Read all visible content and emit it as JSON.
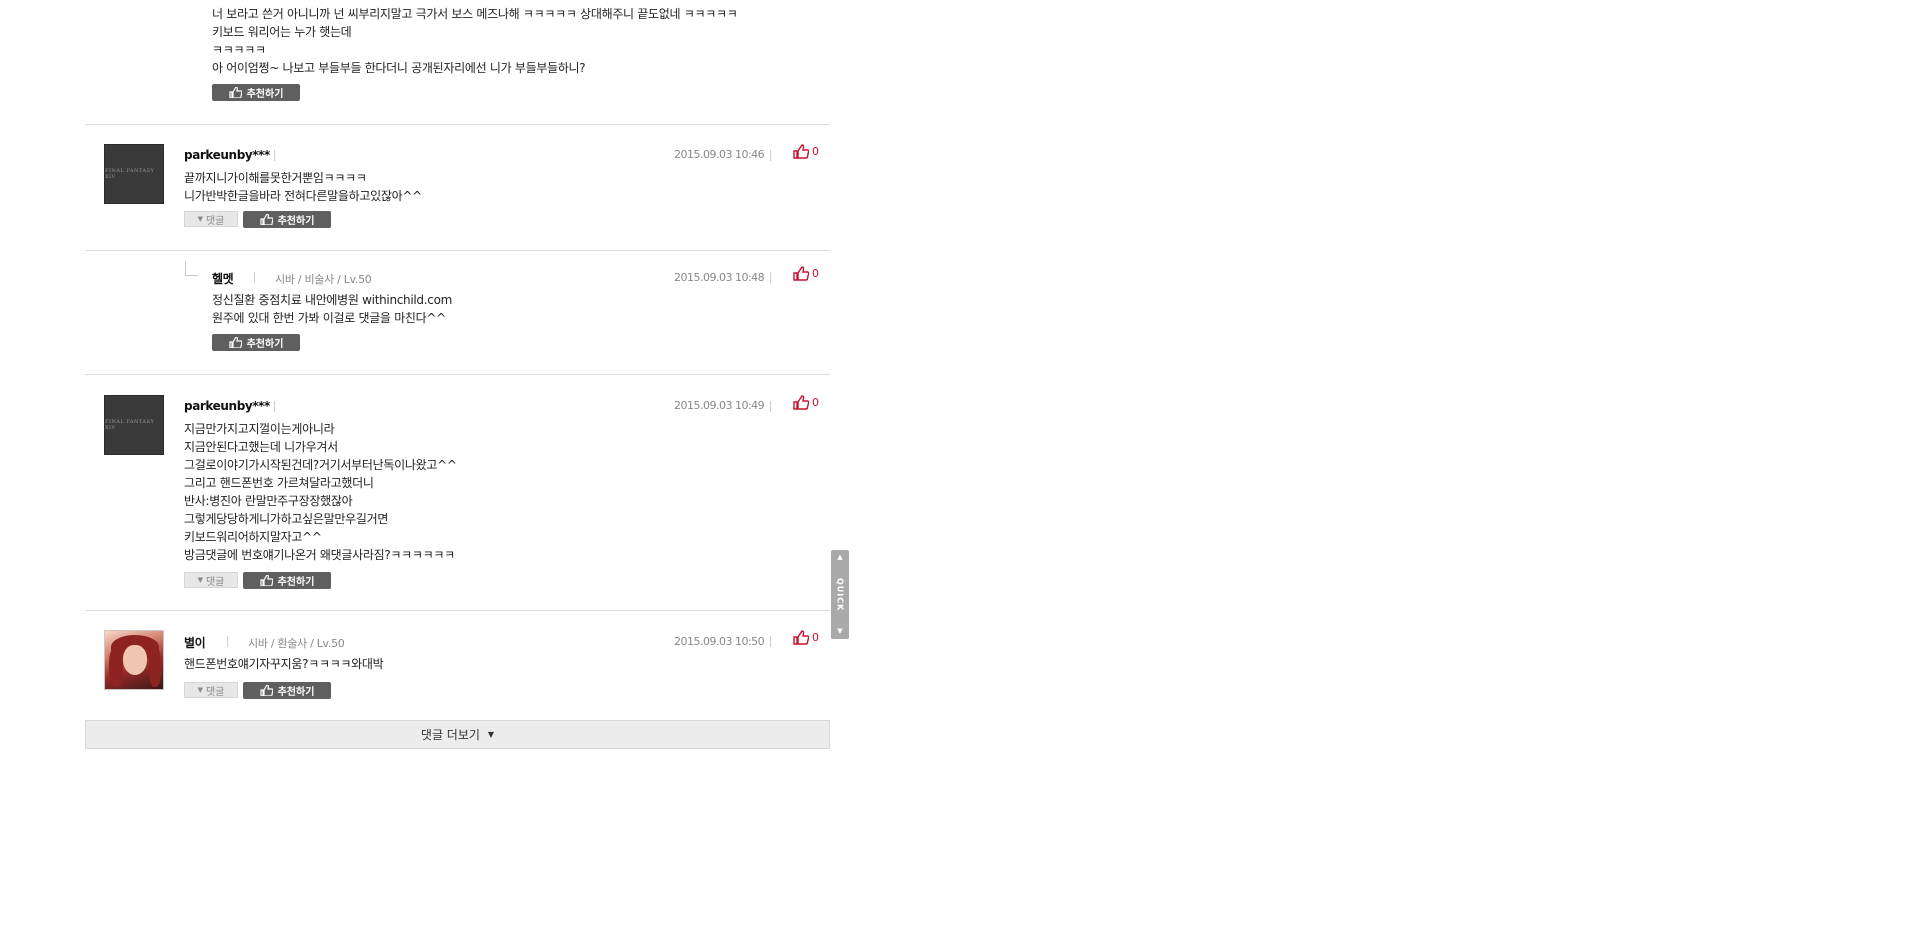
{
  "comments": [
    {
      "id": "c0",
      "lines": [
        "너 보라고 쓴거 아니니까 넌 씨부리지말고 극가서 보스 메즈나해 ㅋㅋㅋㅋㅋ 상대해주니 끝도없네 ㅋㅋㅋㅋㅋ",
        "키보드 워리어는 누가 햇는데",
        "ㅋㅋㅋㅋㅋ",
        "아 어이엄쩡~ 나보고 부들부들 한다더니 공개된자리에선 니가 부들부들하니?"
      ],
      "recommend_label": "추천하기"
    },
    {
      "id": "c1",
      "author": "parkeunby***",
      "avatar_text": "FINAL FANTASY XIV",
      "date": "2015.09.03 10:46",
      "likes": "0",
      "lines": [
        "끝까지니가이해를못한거뿐임ㅋㅋㅋㅋ",
        "니가반박한글을바라 전혀다른말을하고있잖아^^"
      ],
      "reply_label": "댓글",
      "recommend_label": "추천하기"
    },
    {
      "id": "c2",
      "author": "헬멧",
      "info": "시바 / 비술사 / Lv.50",
      "date": "2015.09.03 10:48",
      "likes": "0",
      "lines": [
        "정신질환 중점치료 내안에병원 withinchild.com",
        "원주에 있대 한번 가봐 이걸로 댓글을 마친다^^"
      ],
      "recommend_label": "추천하기"
    },
    {
      "id": "c3",
      "author": "parkeunby***",
      "avatar_text": "FINAL FANTASY XIV",
      "date": "2015.09.03 10:49",
      "likes": "0",
      "lines": [
        "지금만가지고지껄이는게아니라",
        "지금안된다고했는데 니가우겨서",
        "그걸로이야기가시작된건데?거기서부터난독이나왔고^^",
        "그리고 핸드폰번호 가르쳐달라고했더니",
        "반사:병진아 란말만주구장장했잖아",
        "그렇게당당하게니가하고싶은말만우길거면",
        "키보드워리어하지말자고^^",
        "방금댓글에 번호얘기나온거 왜댓글사라짐?ㅋㅋㅋㅋㅋㅋ"
      ],
      "reply_label": "댓글",
      "recommend_label": "추천하기"
    },
    {
      "id": "c4",
      "author": "별이",
      "info": "시바 / 환술사 / Lv.50",
      "date": "2015.09.03 10:50",
      "likes": "0",
      "lines": [
        "핸드폰번호얘기자꾸지움?ㅋㅋㅋㅋ와대박"
      ],
      "reply_label": "댓글",
      "recommend_label": "추천하기"
    }
  ],
  "more_label": "댓글 더보기",
  "quick_label": "QUICK",
  "colors": {
    "like": "#c8102e",
    "recommend_bg": "#5f5f5f",
    "divider": "#dcdcdc",
    "more_bg": "#ececec"
  }
}
